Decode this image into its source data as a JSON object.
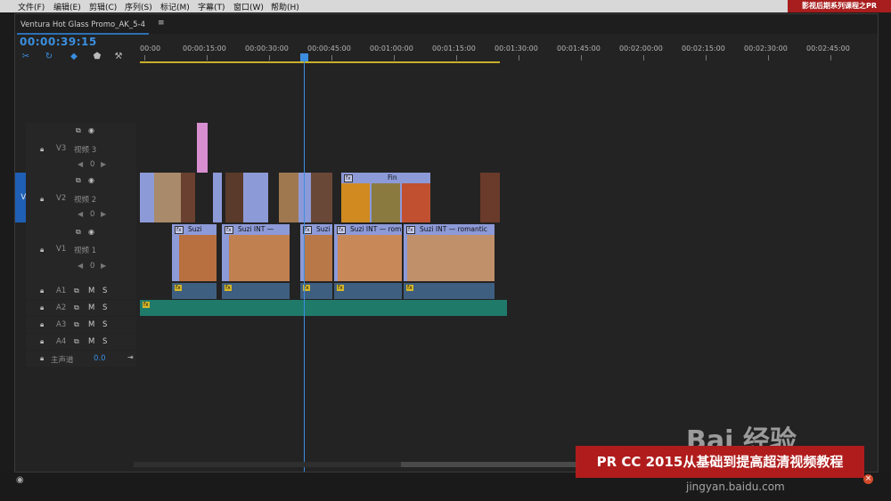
{
  "menu": [
    "文件(F)",
    "编辑(E)",
    "剪辑(C)",
    "序列(S)",
    "标记(M)",
    "字幕(T)",
    "窗口(W)",
    "帮助(H)"
  ],
  "brand": "影视后期系列课程之PR",
  "sequence": {
    "tab": "Ventura Hot Glass Promo_AK_5-4",
    "menu_icon": "≡",
    "timecode": "00:00:39:15"
  },
  "ruler": [
    "00:00",
    "00:00:15:00",
    "00:00:30:00",
    "00:00:45:00",
    "00:01:00:00",
    "00:01:15:00",
    "00:01:30:00",
    "00:01:45:00",
    "00:02:00:00",
    "00:02:15:00",
    "00:02:30:00",
    "00:02:45:00"
  ],
  "tracks": {
    "video": [
      {
        "id": "V3",
        "name": "视频 3",
        "level": "0"
      },
      {
        "id": "V2",
        "name": "视频 2",
        "level": "0"
      },
      {
        "id": "V1",
        "name": "视频 1",
        "level": "0"
      }
    ],
    "source_patch": "V1",
    "audio": [
      "A1",
      "A2",
      "A3",
      "A4"
    ],
    "audio_m": "M",
    "audio_s": "S",
    "master": {
      "label": "主声道",
      "value": "0.0"
    }
  },
  "clips": {
    "v2_label": "Fin",
    "v1_labels": [
      "Suzi",
      "Suzi INT — ",
      "Suzi",
      "Suzi INT — rom",
      "Suzi INT — romantic"
    ]
  },
  "watermark": {
    "banner": "PR CC 2015从基础到提高超清视频教程",
    "logo": "Bai 经验",
    "url": "jingyan.baidu.com"
  },
  "colors": {
    "timecode": "#3a8fe0",
    "brand": "#a81d1d",
    "audio_green": "#1f7a6a",
    "v1_active": "#1f5fb5"
  }
}
